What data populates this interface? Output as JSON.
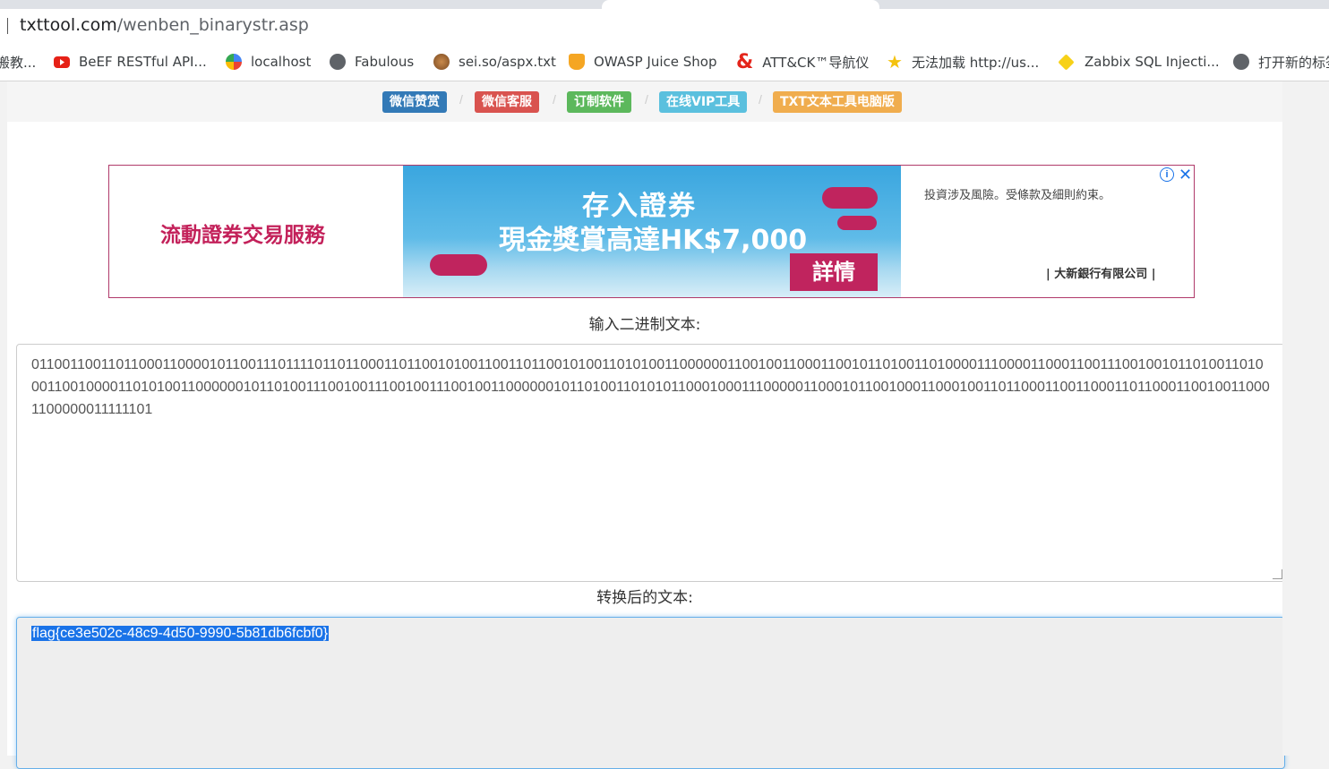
{
  "browser": {
    "url_host": "txttool.com",
    "url_path": "/wenben_binarystr.asp",
    "bookmarks": [
      {
        "label": "搬教...",
        "icon": "clipped-icon"
      },
      {
        "label": "BeEF RESTful API...",
        "icon": "youtube-icon"
      },
      {
        "label": "localhost",
        "icon": "colorful-globe-icon"
      },
      {
        "label": "Fabulous",
        "icon": "globe-icon"
      },
      {
        "label": "sei.so/aspx.txt",
        "icon": "ball-icon"
      },
      {
        "label": "OWASP Juice Shop",
        "icon": "juice-icon"
      },
      {
        "label": "ATT&CK™导航仪",
        "icon": "ampersand-icon"
      },
      {
        "label": "无法加载 http://us...",
        "icon": "star-icon"
      },
      {
        "label": "Zabbix SQL Injecti...",
        "icon": "diamond-icon"
      },
      {
        "label": "打开新的标签",
        "icon": "globe-icon"
      }
    ]
  },
  "nav_badges": [
    {
      "label": "微信赞赏",
      "color": "#337ab7"
    },
    {
      "label": "微信客服",
      "color": "#d9534f"
    },
    {
      "label": "订制软件",
      "color": "#5cb85c"
    },
    {
      "label": "在线VIP工具",
      "color": "#5bc0de"
    },
    {
      "label": "TXT文本工具电脑版",
      "color": "#f0ad4e"
    }
  ],
  "nav_separator": "/",
  "ad": {
    "left_text": "流動證券交易服務",
    "headline_1": "存入證券",
    "headline_2": "現金獎賞高達HK$7,000",
    "cta": "詳情",
    "disclaimer": "投資涉及風險。受條款及細則約束。",
    "bank": "| 大新銀行有限公司 |",
    "info_icon": "info-icon",
    "close_icon": "close-icon"
  },
  "input": {
    "label": "输入二进制文本:",
    "value": "0110011001101100011000010110011101111011011000110110010100110011011001010011010100110000001100100110001100101101001101000011100001100011001110010010110100110100011001000011010100110000001011010011100100111001001110010011000000101101001101010110001000111000001100010110010001100010011011000110011000110110001100100110001100000011111101"
  },
  "output": {
    "label": "转换后的文本:",
    "value": "flag{ce3e502c-48c9-4d50-9990-5b81db6fcbf0}"
  }
}
